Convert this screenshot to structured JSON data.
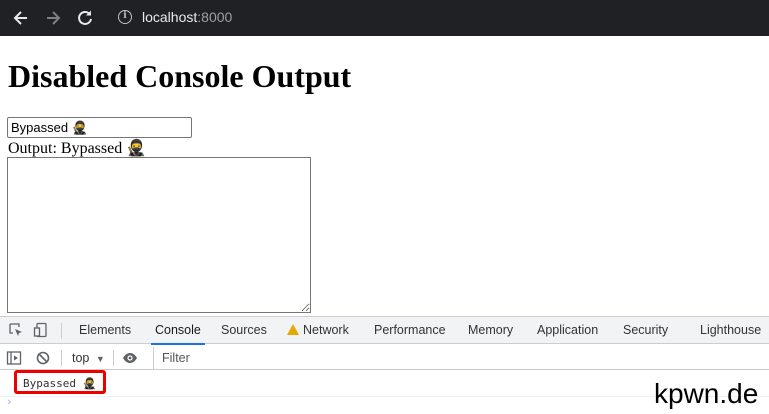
{
  "browser": {
    "back_icon": "arrow-left-icon",
    "forward_icon": "arrow-right-icon",
    "reload_icon": "reload-icon",
    "url_host": "localhost",
    "url_port": ":8000"
  },
  "page": {
    "title": "Disabled Console Output",
    "input_value": "Bypassed 🥷",
    "output_label": "Output: Bypassed 🥷"
  },
  "devtools": {
    "tabs": [
      {
        "label": "Elements"
      },
      {
        "label": "Console",
        "active": true
      },
      {
        "label": "Sources"
      },
      {
        "label": "Network",
        "warning": true
      },
      {
        "label": "Performance"
      },
      {
        "label": "Memory"
      },
      {
        "label": "Application"
      },
      {
        "label": "Security"
      },
      {
        "label": "Lighthouse"
      }
    ],
    "context": "top",
    "filter_placeholder": "Filter",
    "console_message": "Bypassed 🥷",
    "highlight_color": "#ee0000"
  },
  "watermark": "kpwn.de"
}
